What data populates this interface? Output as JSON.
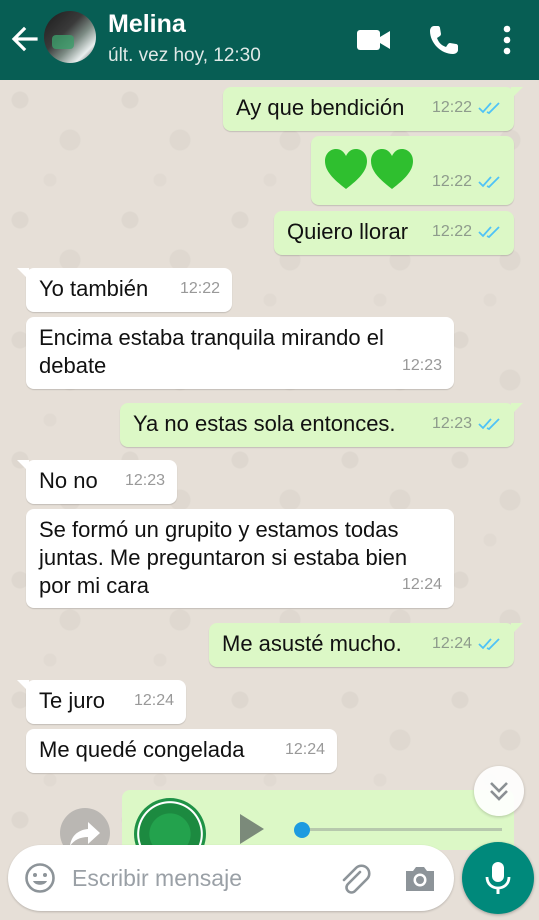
{
  "header": {
    "contact_name": "Melina",
    "last_seen": "últ. vez hoy, 12:30",
    "bar_color": "#075e54"
  },
  "messages": [
    {
      "direction": "out",
      "text": "Ay que bendición",
      "time": "12:22",
      "status": "read"
    },
    {
      "direction": "out",
      "text": "",
      "emoji": "green-heart-icon green-heart-icon",
      "time": "12:22",
      "status": "read"
    },
    {
      "direction": "out",
      "text": "Quiero llorar",
      "time": "12:22",
      "status": "read"
    },
    {
      "direction": "in",
      "text": "Yo también",
      "time": "12:22"
    },
    {
      "direction": "in",
      "text": "Encima estaba tranquila mirando el debate",
      "lines": [
        "Encima estaba tranquila mirando el",
        "debate"
      ],
      "time": "12:23"
    },
    {
      "direction": "out",
      "text": "Ya no estas sola entonces.",
      "time": "12:23",
      "status": "read"
    },
    {
      "direction": "in",
      "text": "No no",
      "time": "12:23"
    },
    {
      "direction": "in",
      "text": "Se formó un grupito y estamos todas juntas. Me preguntaron si estaba bien por mi cara",
      "lines": [
        "Se formó un grupito y estamos todas",
        "juntas. Me preguntaron si estaba bien",
        "por mi cara"
      ],
      "time": "12:24"
    },
    {
      "direction": "out",
      "text": "Me asusté mucho.",
      "time": "12:24",
      "status": "read"
    },
    {
      "direction": "in",
      "text": "Te juro",
      "time": "12:24"
    },
    {
      "direction": "in",
      "text": "Me quedé congelada",
      "time": "12:24"
    }
  ],
  "composer": {
    "placeholder": "Escribir mensaje"
  },
  "colors": {
    "outgoing_bubble": "#dcf8c6",
    "incoming_bubble": "#ffffff",
    "read_check": "#4fc3f7",
    "fab": "#00897b"
  }
}
